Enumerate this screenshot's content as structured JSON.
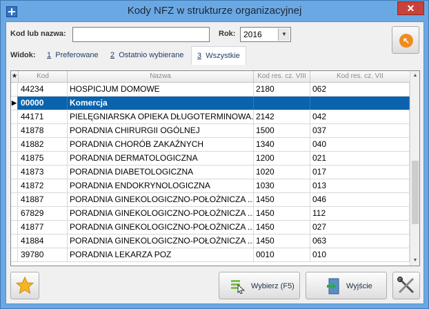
{
  "window": {
    "title": "Kody NFZ w strukturze organizacyjnej",
    "close_glyph": "✕"
  },
  "filters": {
    "search_label": "Kod lub nazwa:",
    "search_value": "",
    "year_label": "Rok:",
    "year_value": "2016"
  },
  "view": {
    "label": "Widok:",
    "tabs": [
      {
        "num": "1",
        "label": "Preferowane"
      },
      {
        "num": "2",
        "label": "Ostatnio wybierane"
      },
      {
        "num": "3",
        "label": "Wszystkie"
      }
    ],
    "active_index": 2
  },
  "grid": {
    "headers": {
      "marker": "★",
      "kod": "Kod",
      "nazwa": "Nazwa",
      "viii": "Kod res. cz. VIII",
      "vii": "Kod res. cz. VII"
    },
    "rows": [
      {
        "kod": "44234",
        "nazwa": "HOSPICJUM DOMOWE",
        "viii": "2180",
        "vii": "062"
      },
      {
        "kod": "00000",
        "nazwa": "Komercja",
        "viii": "",
        "vii": "",
        "selected": true
      },
      {
        "kod": "44171",
        "nazwa": "PIELĘGNIARSKA OPIEKA DŁUGOTERMINOWA...",
        "viii": "2142",
        "vii": "042"
      },
      {
        "kod": "41878",
        "nazwa": "PORADNIA CHIRURGII OGÓLNEJ",
        "viii": "1500",
        "vii": "037"
      },
      {
        "kod": "41882",
        "nazwa": "PORADNIA CHORÓB ZAKAŹNYCH",
        "viii": "1340",
        "vii": "040"
      },
      {
        "kod": "41875",
        "nazwa": "PORADNIA DERMATOLOGICZNA",
        "viii": "1200",
        "vii": "021"
      },
      {
        "kod": "41873",
        "nazwa": "PORADNIA DIABETOLOGICZNA",
        "viii": "1020",
        "vii": "017"
      },
      {
        "kod": "41872",
        "nazwa": "PORADNIA ENDOKRYNOLOGICZNA",
        "viii": "1030",
        "vii": "013"
      },
      {
        "kod": "41887",
        "nazwa": "PORADNIA GINEKOLOGICZNO-POŁOŻNICZA ...",
        "viii": "1450",
        "vii": "046"
      },
      {
        "kod": "67829",
        "nazwa": "PORADNIA GINEKOLOGICZNO-POŁOŻNICZA ...",
        "viii": "1450",
        "vii": "112"
      },
      {
        "kod": "41877",
        "nazwa": "PORADNIA GINEKOLOGICZNO-POŁOŻNICZA ...",
        "viii": "1450",
        "vii": "027"
      },
      {
        "kod": "41884",
        "nazwa": "PORADNIA GINEKOLOGICZNO-POŁOŻNICZA ...",
        "viii": "1450",
        "vii": "063"
      },
      {
        "kod": "39780",
        "nazwa": "PORADNIA LEKARZA POZ",
        "viii": "0010",
        "vii": "010"
      }
    ]
  },
  "buttons": {
    "wybierz": "Wybierz (F5)",
    "wyjscie": "Wyjście"
  },
  "colors": {
    "selection": "#0b63ad",
    "frame": "#6aa8e4"
  }
}
